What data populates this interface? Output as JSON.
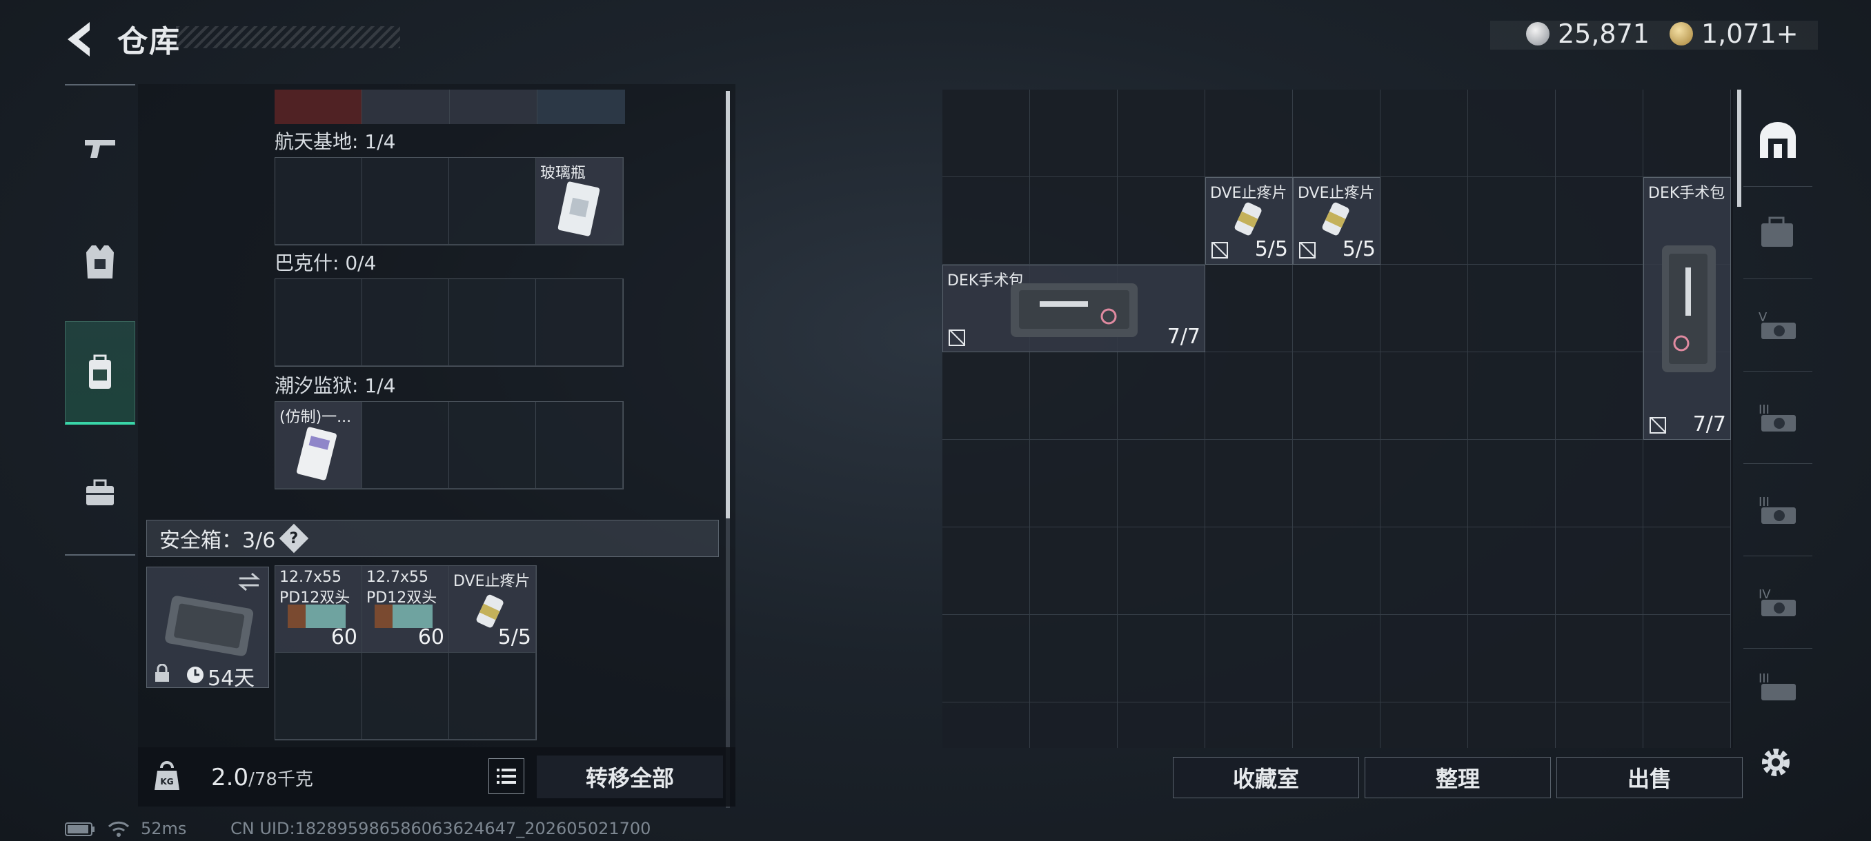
{
  "header": {
    "title": "仓库"
  },
  "currency": {
    "silver": "25,871",
    "gold": "1,071+"
  },
  "left_sidebar": {
    "items": [
      "gun-icon",
      "vest-icon",
      "backpack-icon",
      "toolbox-icon"
    ],
    "active": "backpack-icon"
  },
  "collections": [
    {
      "label": "航天基地: 1/4",
      "items": [
        {
          "name": "玻璃瓶"
        }
      ]
    },
    {
      "label": "巴克什: 0/4",
      "items": []
    },
    {
      "label": "潮汐监狱: 1/4",
      "items": [
        {
          "name": "(仿制)一..."
        }
      ]
    }
  ],
  "safebox": {
    "label": "安全箱：3/6",
    "help": "?",
    "expire": "54天",
    "items": [
      {
        "name1": "12.7x55",
        "name2": "PD12双头",
        "count": "60"
      },
      {
        "name1": "12.7x55",
        "name2": "PD12双头",
        "count": "60"
      },
      {
        "name1": "DVE止疼片",
        "name2": "",
        "count": "5/5"
      }
    ]
  },
  "footer": {
    "weight": "2.0",
    "capacity": "/78千克",
    "transfer_all": "转移全部",
    "kg": "KG"
  },
  "stash": {
    "items": [
      {
        "name": "DVE止疼片",
        "count": "5/5"
      },
      {
        "name": "DVE止疼片",
        "count": "5/5"
      },
      {
        "name": "DEK手术包",
        "count": "7/7"
      },
      {
        "name": "DEK手术包",
        "count": "7/7"
      }
    ]
  },
  "actions": {
    "collection_room": "收藏室",
    "sort": "整理",
    "sell": "出售"
  },
  "right_sidebar": {
    "items": [
      "stash-tab-icon",
      "case-icon",
      "level-v-icon",
      "level-iii-icon",
      "level-iii-b-icon",
      "level-iv-icon",
      "level-iii-c-icon"
    ],
    "tier_labels": [
      "V",
      "III",
      "III",
      "IV",
      "III"
    ]
  },
  "status": {
    "ping": "52ms",
    "uid": "CN UID:1828959865860636246​47_202605021700"
  },
  "colors": {
    "accent": "#39d6a8",
    "text": "#e6e9ec",
    "panel": "#1c232b"
  }
}
